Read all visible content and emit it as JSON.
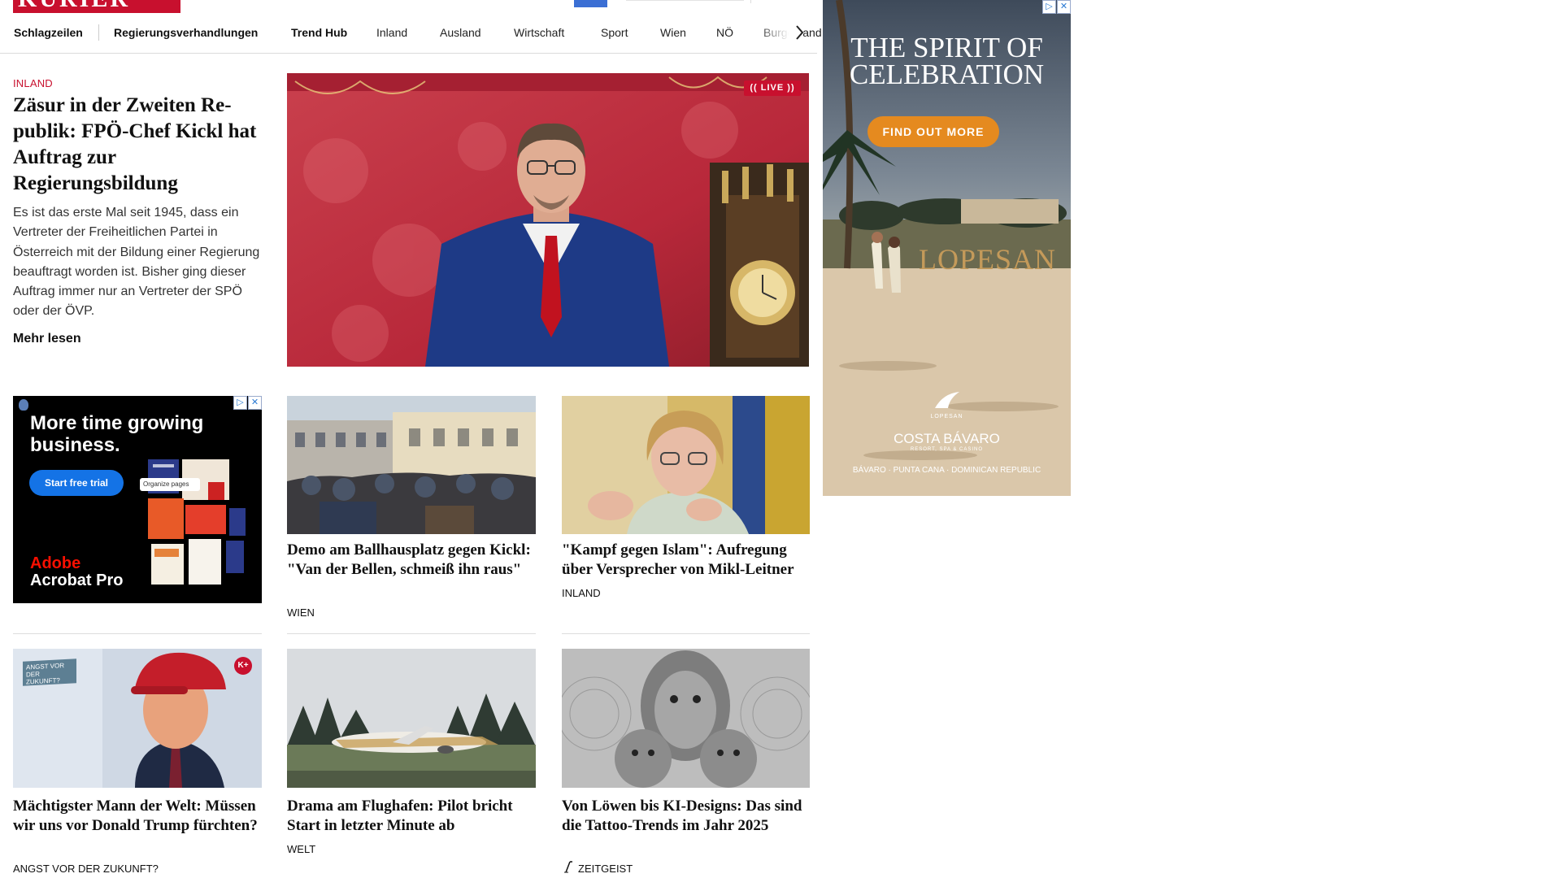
{
  "brand": {
    "logo_text": "KURIER",
    "color": "#c8102e"
  },
  "nav": {
    "items": [
      {
        "label": "Schlagzeilen"
      },
      {
        "label": "Regierungsverhandlungen"
      },
      {
        "label": "Trend Hub"
      },
      {
        "label": "Inland"
      },
      {
        "label": "Ausland"
      },
      {
        "label": "Wirtschaft"
      },
      {
        "label": "Sport"
      },
      {
        "label": "Wien"
      },
      {
        "label": "NÖ"
      },
      {
        "label": "Burgenland"
      }
    ],
    "arrow_icon": "chevron-right-icon"
  },
  "lead": {
    "kicker": "INLAND",
    "title": "Zäsur in der Zweiten Re­publik: FPÖ-Chef Kickl hat Auftrag zur Regierungsbildung",
    "text": "Es ist das erste Mal seit 1945, dass ein Vertreter der Freiheitlichen Partei in Österreich mit der Bildung einer Regierung beauftragt worden ist. Bisher ging dieser Auftrag immer nur an Vertreter der SPÖ oder der ÖVP.",
    "more": "Mehr lesen",
    "live_badge": "(( LIVE ))"
  },
  "ad_small": {
    "headline": "More time growing business.",
    "cta": "Start free trial",
    "chip": "Organize pages",
    "brand_top": "Adobe",
    "brand_bottom": "Acrobat Pro"
  },
  "ad_right": {
    "headline": "THE SPIRIT OF CELEBRATION",
    "cta": "FIND OUT MORE",
    "sign": "LOPESAN",
    "brand_small": "LOPESAN",
    "brand": "COSTA BÁVARO",
    "brand_sub": "RESORT, SPA & CASINO",
    "footer": "BÁVARO · PUNTA CANA · DOMINICAN REPUBLIC"
  },
  "ad_marks": {
    "info": "▷",
    "close": "✕"
  },
  "cards": [
    {
      "title": "Demo am Ballhausplatz gegen Kickl: \"Van der Bellen, schmeiß ihn raus\"",
      "tag": "WIEN"
    },
    {
      "title": "\"Kampf gegen Islam\": Aufregung über Versprecher von Mikl-Leitner",
      "tag": "INLAND"
    },
    {
      "title": "Mächtigster Mann der Welt: Müs­sen wir uns vor Donald Trump fürchten?",
      "tag": "ANGST VOR DER ZUKUNFT?",
      "image_badge": "ANGST VOR DER ZUKUNFT?",
      "plus_badge": "K+"
    },
    {
      "title": "Drama am Flughafen: Pilot bricht Start in letzter Minute ab",
      "tag": "WELT"
    },
    {
      "title": "Von Löwen bis KI-Designs: Das sind die Tattoo-Trends im Jahr 2025",
      "tag": "ZEITGEIST",
      "tag_icon": "pen-icon"
    }
  ]
}
